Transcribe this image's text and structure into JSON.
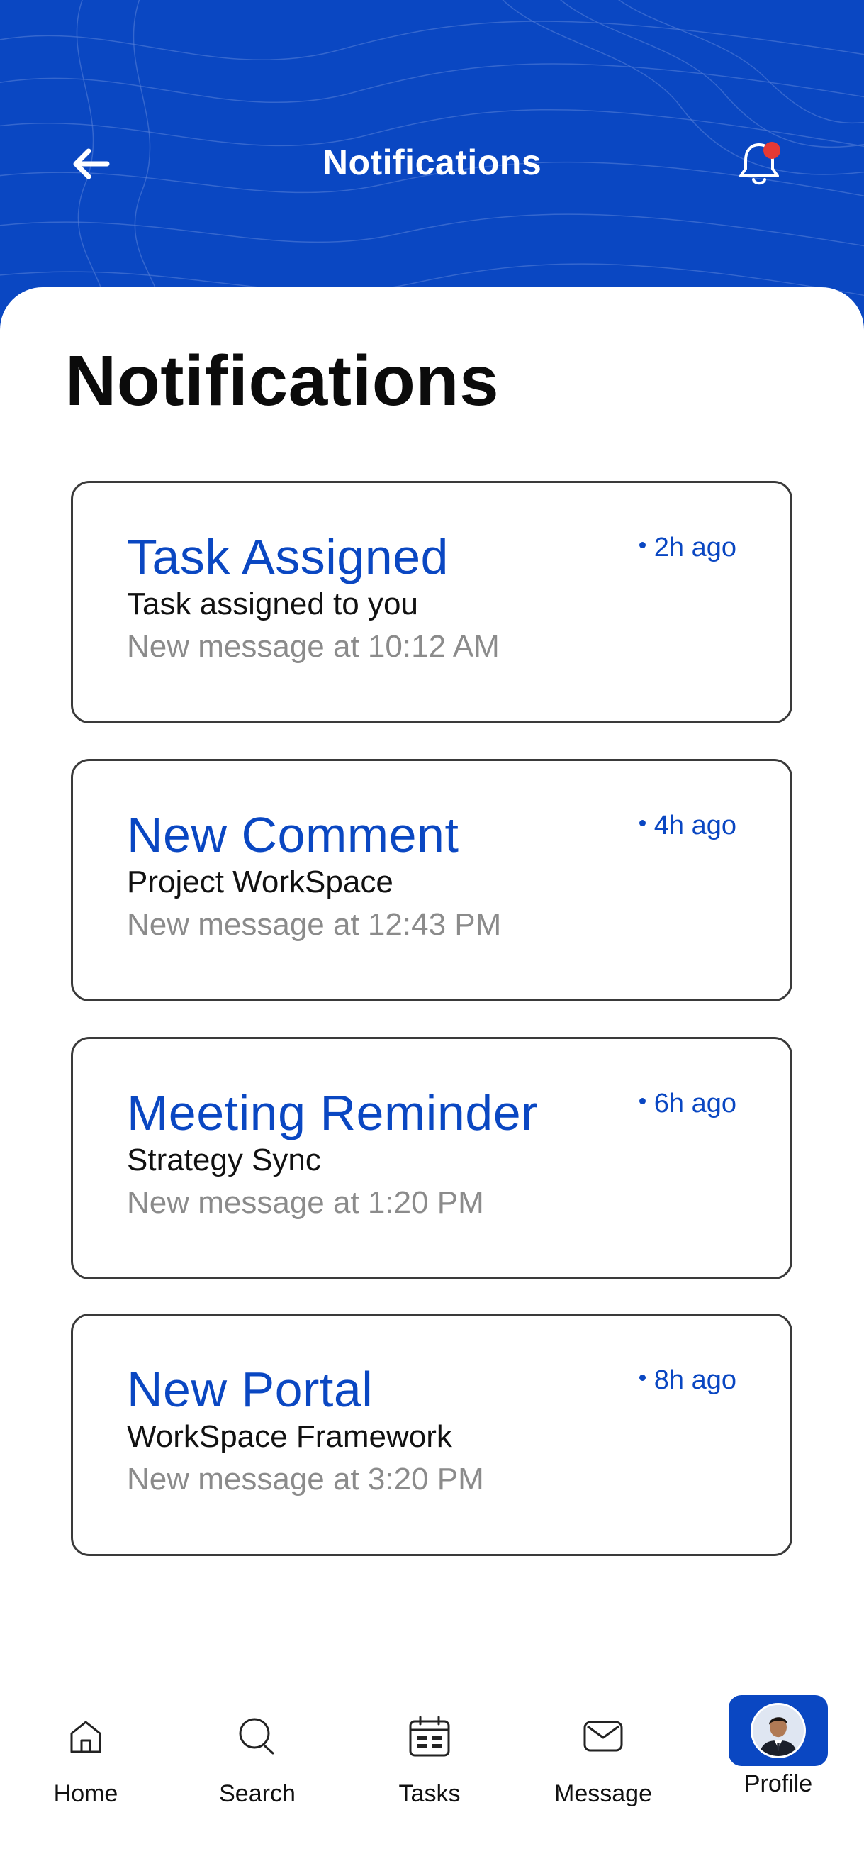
{
  "header": {
    "title": "Notifications",
    "back_icon": "arrow-left-icon",
    "bell_icon": "bell-icon",
    "has_unread_dot": true
  },
  "colors": {
    "primary": "#0a47c2",
    "badge_red": "#e53935",
    "muted_text": "#8b8b8b"
  },
  "page": {
    "title": "Notifications"
  },
  "notifications": [
    {
      "title": "Task Assigned",
      "subtitle": "Task assigned to you",
      "message": "New message at 10:12 AM",
      "time": "2h ago"
    },
    {
      "title": "New Comment",
      "subtitle": "Project WorkSpace",
      "message": "New message at 12:43 PM",
      "time": "4h ago"
    },
    {
      "title": "Meeting Reminder",
      "subtitle": "Strategy Sync",
      "message": "New message at 1:20 PM",
      "time": "6h ago"
    },
    {
      "title": "New Portal",
      "subtitle": "WorkSpace Framework",
      "message": "New message at 3:20 PM",
      "time": "8h ago"
    }
  ],
  "nav": {
    "items": [
      {
        "label": "Home",
        "icon": "home-icon"
      },
      {
        "label": "Search",
        "icon": "search-icon"
      },
      {
        "label": "Tasks",
        "icon": "calendar-icon"
      },
      {
        "label": "Message",
        "icon": "mail-icon"
      },
      {
        "label": "Profile",
        "icon": "avatar",
        "active": true
      }
    ]
  }
}
